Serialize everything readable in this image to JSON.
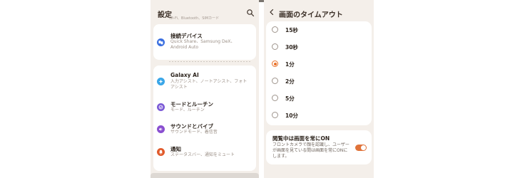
{
  "left_panel": {
    "title": "設定",
    "cut_text": "Wi-Fi、Bluetooth、SIMカード",
    "items": [
      {
        "title": "接続デバイス",
        "subtitle": "Quick Share、Samsung DeX、Android Auto",
        "icon": "connected-devices-icon",
        "color": "#3b6fe0"
      },
      {
        "title": "Galaxy AI",
        "subtitle": "入力アシスト、ノートアシスト、フォトアシスト",
        "icon": "galaxy-ai-icon",
        "color": "#3aa6e8"
      },
      {
        "title": "モードとルーチン",
        "subtitle": "モード、ルーチン",
        "icon": "modes-routines-icon",
        "color": "#7b5ad6"
      },
      {
        "title": "サウンドとバイブ",
        "subtitle": "サウンドモード、着信音",
        "icon": "sound-icon",
        "color": "#8a4fd0"
      },
      {
        "title": "通知",
        "subtitle": "ステータスバー、通知をミュート",
        "icon": "notification-icon",
        "color": "#e15a2b"
      }
    ]
  },
  "right_panel": {
    "title": "画面のタイムアウト",
    "options": [
      {
        "label": "15秒",
        "selected": false
      },
      {
        "label": "30秒",
        "selected": false
      },
      {
        "label": "1分",
        "selected": true
      },
      {
        "label": "2分",
        "selected": false
      },
      {
        "label": "5分",
        "selected": false
      },
      {
        "label": "10分",
        "selected": false
      }
    ],
    "keep_on": {
      "title": "閲覧中は画面を常にON",
      "description": "フロントカメラで顔を認識し、ユーザーが画面を見ている間は画面を常にONにします。",
      "enabled": true
    }
  },
  "colors": {
    "accent": "#e8722a",
    "background": "#f4efea",
    "card": "#ffffff"
  }
}
